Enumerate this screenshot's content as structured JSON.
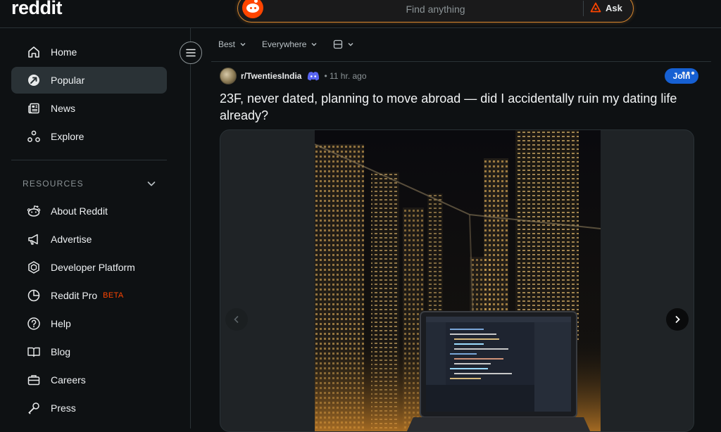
{
  "header": {
    "logo": "reddit",
    "search": {
      "placeholder": "Find anything"
    },
    "ask_label": "Ask"
  },
  "sidebar": {
    "primary": [
      {
        "label": "Home",
        "icon": "home-icon"
      },
      {
        "label": "Popular",
        "icon": "popular-icon",
        "active": true
      },
      {
        "label": "News",
        "icon": "news-icon"
      },
      {
        "label": "Explore",
        "icon": "explore-icon"
      }
    ],
    "resources_heading": "RESOURCES",
    "resources": [
      {
        "label": "About Reddit",
        "icon": "reddit-alien-icon"
      },
      {
        "label": "Advertise",
        "icon": "megaphone-icon"
      },
      {
        "label": "Developer Platform",
        "icon": "developer-icon"
      },
      {
        "label": "Reddit Pro",
        "icon": "pro-chart-icon",
        "badge": "BETA"
      },
      {
        "label": "Help",
        "icon": "help-icon"
      },
      {
        "label": "Blog",
        "icon": "blog-icon"
      },
      {
        "label": "Careers",
        "icon": "briefcase-icon"
      },
      {
        "label": "Press",
        "icon": "microphone-icon"
      }
    ]
  },
  "feed": {
    "sort": {
      "order": "Best",
      "scope": "Everywhere",
      "view": "card-view-icon"
    },
    "post": {
      "subreddit": "r/TwentiesIndia",
      "time": "11 hr. ago",
      "join_label": "Join",
      "title": "23F, never dated, planning to move abroad — did I accidentally ruin my dating life already?",
      "image_alt": "Night city view from a high-rise balcony with a laptop showing code"
    }
  },
  "colors": {
    "background": "#0e1113",
    "accent": "#ff4500",
    "join": "#1660d3",
    "search_border": "#d6862e",
    "active_item": "#2a3236"
  }
}
